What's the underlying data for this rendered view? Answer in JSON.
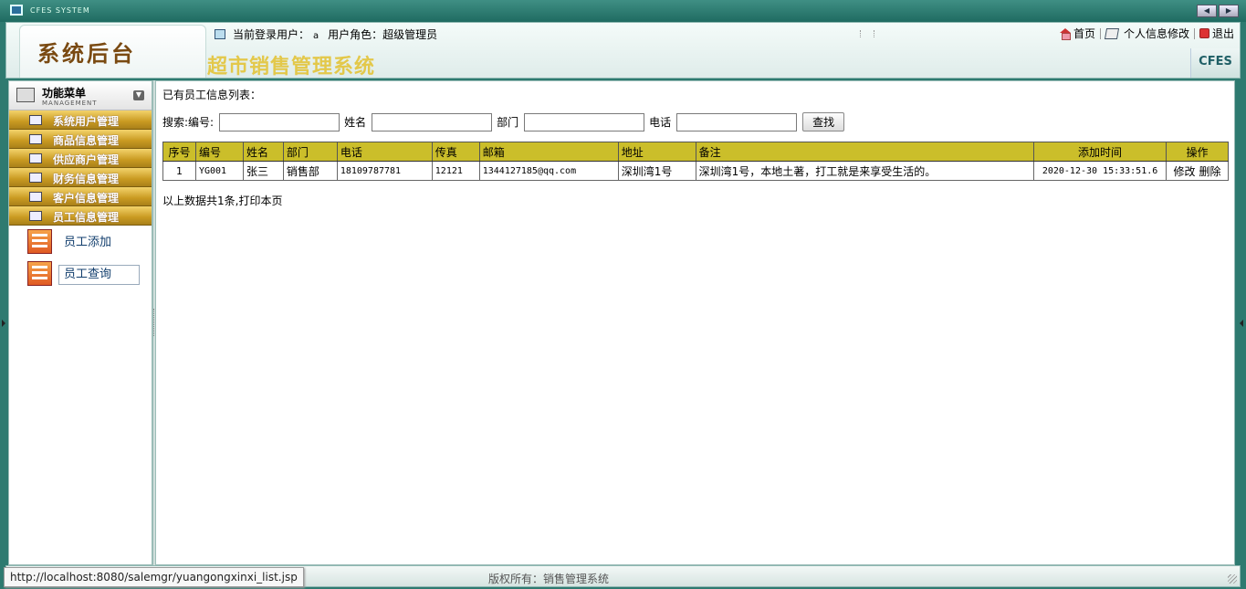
{
  "window": {
    "title": "CFES SYSTEM"
  },
  "header": {
    "logo": "系统后台",
    "system_name": "超市销售管理系统",
    "current_user_label": "当前登录用户：",
    "current_user": "a",
    "role_label": "用户角色：",
    "role": "超级管理员",
    "links": {
      "home": "首页",
      "profile": "个人信息修改",
      "logout": "退出"
    },
    "brand": "CFES"
  },
  "sidebar": {
    "title": "功能菜单",
    "subtitle": "MANAGEMENT",
    "items": [
      {
        "label": "系统用户管理"
      },
      {
        "label": "商品信息管理"
      },
      {
        "label": "供应商户管理"
      },
      {
        "label": "财务信息管理"
      },
      {
        "label": "客户信息管理"
      },
      {
        "label": "员工信息管理"
      }
    ],
    "subitems": [
      {
        "label": "员工添加"
      },
      {
        "label": "员工查询"
      }
    ]
  },
  "main": {
    "list_title": "已有员工信息列表：",
    "search": {
      "label_id": "搜索:编号:",
      "label_name": "姓名",
      "label_dept": "部门",
      "label_phone": "电话",
      "button": "查找"
    },
    "table": {
      "columns": [
        "序号",
        "编号",
        "姓名",
        "部门",
        "电话",
        "传真",
        "邮箱",
        "地址",
        "备注",
        "添加时间",
        "操作"
      ],
      "rows": [
        {
          "index": "1",
          "id": "YG001",
          "name": "张三",
          "dept": "销售部",
          "phone": "18109787781",
          "fax": "12121",
          "email": "1344127185@qq.com",
          "address": "深圳湾1号",
          "note": "深圳湾1号，本地土著，打工就是来享受生活的。",
          "time": "2020-12-30 15:33:51.6",
          "edit": "修改",
          "delete": "删除"
        }
      ]
    },
    "summary_prefix": "以上数据共1条,",
    "print_link": "打印本页"
  },
  "footer": {
    "copyright": "版权所有：销售管理系统"
  },
  "statusbar": {
    "url": "http://localhost:8080/salemgr/yuangongxinxi_list.jsp"
  }
}
